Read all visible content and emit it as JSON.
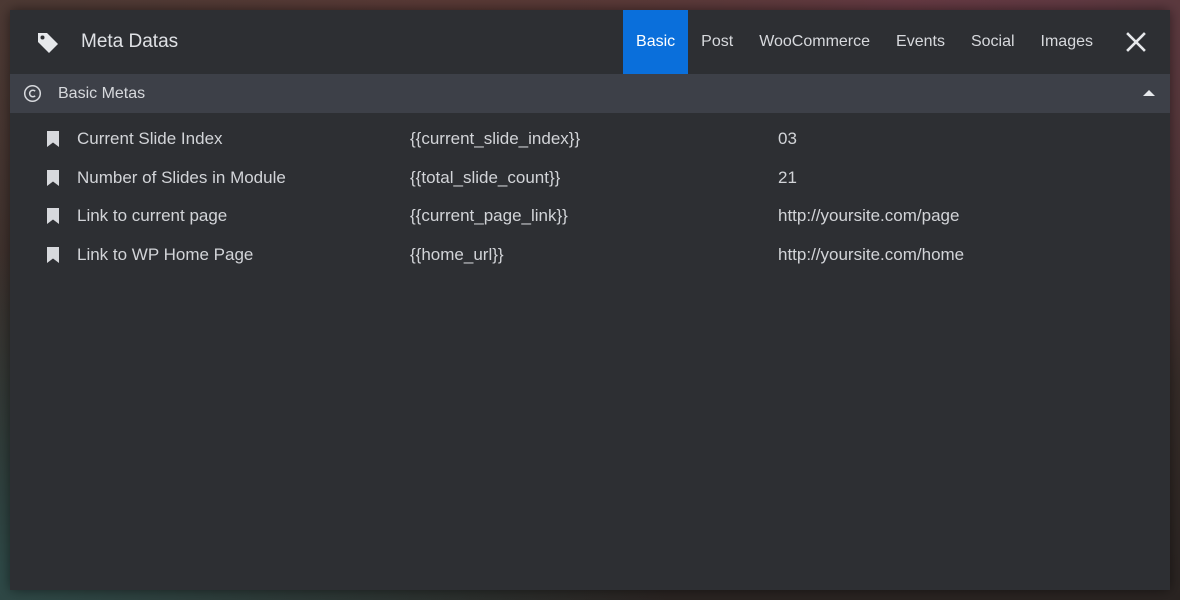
{
  "header": {
    "title": "Meta Datas",
    "icon": "tag-icon",
    "tabs": [
      {
        "label": "Basic",
        "active": true
      },
      {
        "label": "Post",
        "active": false
      },
      {
        "label": "WooCommerce",
        "active": false
      },
      {
        "label": "Events",
        "active": false
      },
      {
        "label": "Social",
        "active": false
      },
      {
        "label": "Images",
        "active": false
      }
    ],
    "close_icon": "close-icon",
    "accent_color": "#0a6fdb"
  },
  "section": {
    "title": "Basic Metas",
    "icon": "copyright-icon",
    "toggle_icon": "caret-up-icon"
  },
  "rows": [
    {
      "label": "Current Slide Index",
      "tag": "{{current_slide_index}}",
      "value": "03"
    },
    {
      "label": "Number of Slides in Module",
      "tag": "{{total_slide_count}}",
      "value": "21"
    },
    {
      "label": "Link to current page",
      "tag": "{{current_page_link}}",
      "value": "http://yoursite.com/page"
    },
    {
      "label": "Link to WP Home Page",
      "tag": "{{home_url}}",
      "value": "http://yoursite.com/home"
    }
  ]
}
